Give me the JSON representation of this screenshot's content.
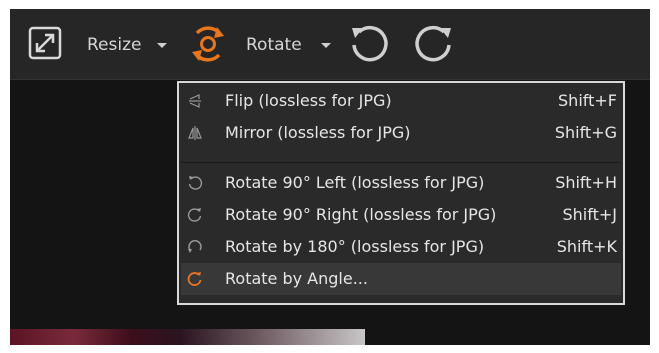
{
  "toolbar": {
    "resize_label": "Resize",
    "rotate_label": "Rotate",
    "accent_color": "#e8761e",
    "icon_color": "#d9d9d9"
  },
  "menu": {
    "items": [
      {
        "label": "Flip (lossless for JPG)",
        "shortcut": "Shift+F",
        "icon": "flip-icon"
      },
      {
        "label": "Mirror (lossless for JPG)",
        "shortcut": "Shift+G",
        "icon": "mirror-icon"
      },
      {
        "label": "Rotate 90° Left (lossless for JPG)",
        "shortcut": "Shift+H",
        "icon": "rotate-left-icon"
      },
      {
        "label": "Rotate 90° Right (lossless for JPG)",
        "shortcut": "Shift+J",
        "icon": "rotate-right-icon"
      },
      {
        "label": "Rotate by 180° (lossless for JPG)",
        "shortcut": "Shift+K",
        "icon": "rotate-180-icon"
      },
      {
        "label": "Rotate by Angle...",
        "shortcut": "",
        "icon": "rotate-angle-icon",
        "highlighted": true
      }
    ]
  }
}
